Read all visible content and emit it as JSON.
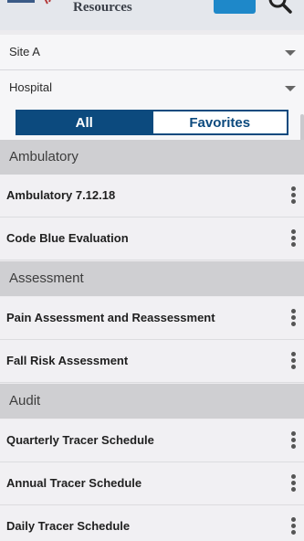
{
  "header": {
    "title": "Resources"
  },
  "filters": {
    "site": "Site A",
    "facility": "Hospital"
  },
  "tabs": {
    "all": "All",
    "favorites": "Favorites"
  },
  "sections": [
    {
      "label": "Ambulatory",
      "items": [
        "Ambulatory 7.12.18",
        "Code Blue Evaluation"
      ]
    },
    {
      "label": "Assessment",
      "items": [
        "Pain Assessment and Reassessment",
        "Fall Risk Assessment"
      ]
    },
    {
      "label": "Audit",
      "items": [
        "Quarterly Tracer Schedule",
        "Annual Tracer Schedule",
        "Daily Tracer Schedule"
      ]
    }
  ],
  "icons": {
    "menu": "hamburger-menu-icon",
    "search": "search-icon",
    "more": "kebab-menu-icon",
    "dropdown": "chevron-down-icon"
  },
  "colors": {
    "primary": "#0c4a7e",
    "header_button": "#1e88c9",
    "section_bg": "#cfcfd2",
    "row_bg": "#f1f0f3"
  }
}
